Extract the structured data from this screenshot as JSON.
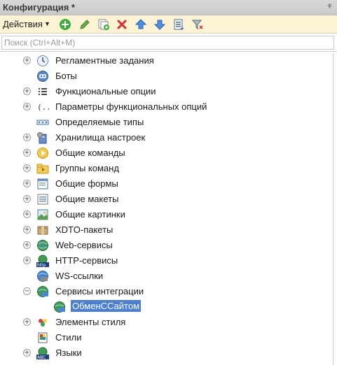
{
  "window": {
    "title": "Конфигурация *",
    "pin_glyph": "ᵠ"
  },
  "toolbar": {
    "actions_label": "Действия",
    "buttons": [
      {
        "name": "add-icon",
        "color": "#3fae3f"
      },
      {
        "name": "edit-icon",
        "color": "#5aa02c"
      },
      {
        "name": "copy-icon",
        "color": "#3fae3f"
      },
      {
        "name": "delete-icon",
        "color": "#d32f2f"
      },
      {
        "name": "move-up-icon",
        "color": "#3a7fd6"
      },
      {
        "name": "move-down-icon",
        "color": "#3a7fd6"
      },
      {
        "name": "list-icon",
        "color": "#4a6fa8"
      },
      {
        "name": "filter-icon",
        "color": "#6c7a8c"
      }
    ]
  },
  "search": {
    "placeholder": "Поиск (Ctrl+Alt+M)",
    "value": ""
  },
  "tree": {
    "items": [
      {
        "label": "Регламентные задания",
        "icon": "scheduled-jobs-icon",
        "expander": "plus"
      },
      {
        "label": "Боты",
        "icon": "bots-icon",
        "expander": "none"
      },
      {
        "label": "Функциональные опции",
        "icon": "functional-options-icon",
        "expander": "plus"
      },
      {
        "label": "Параметры функциональных опций",
        "icon": "functional-options-params-icon",
        "expander": "plus"
      },
      {
        "label": "Определяемые типы",
        "icon": "defined-types-icon",
        "expander": "none"
      },
      {
        "label": "Хранилища настроек",
        "icon": "settings-storage-icon",
        "expander": "plus"
      },
      {
        "label": "Общие команды",
        "icon": "common-commands-icon",
        "expander": "plus"
      },
      {
        "label": "Группы команд",
        "icon": "command-groups-icon",
        "expander": "plus"
      },
      {
        "label": "Общие формы",
        "icon": "common-forms-icon",
        "expander": "plus"
      },
      {
        "label": "Общие макеты",
        "icon": "common-templates-icon",
        "expander": "plus"
      },
      {
        "label": "Общие картинки",
        "icon": "common-pictures-icon",
        "expander": "plus"
      },
      {
        "label": "XDTO-пакеты",
        "icon": "xdto-packages-icon",
        "expander": "plus"
      },
      {
        "label": "Web-сервисы",
        "icon": "web-services-icon",
        "expander": "plus"
      },
      {
        "label": "HTTP-сервисы",
        "icon": "http-services-icon",
        "expander": "plus"
      },
      {
        "label": "WS-ссылки",
        "icon": "ws-references-icon",
        "expander": "none"
      },
      {
        "label": "Сервисы интеграции",
        "icon": "integration-services-icon",
        "expander": "minus"
      },
      {
        "label": "ОбменССайтом",
        "icon": "integration-service-item-icon",
        "expander": "none",
        "selected": true,
        "child": true
      },
      {
        "label": "Элементы стиля",
        "icon": "style-items-icon",
        "expander": "plus"
      },
      {
        "label": "Стили",
        "icon": "styles-icon",
        "expander": "none"
      },
      {
        "label": "Языки",
        "icon": "languages-icon",
        "expander": "plus"
      }
    ]
  },
  "colors": {
    "selection": "#4a7fd4",
    "toolbar_bg": "#fbf3d4",
    "title_bg": "#d0d0d0"
  }
}
